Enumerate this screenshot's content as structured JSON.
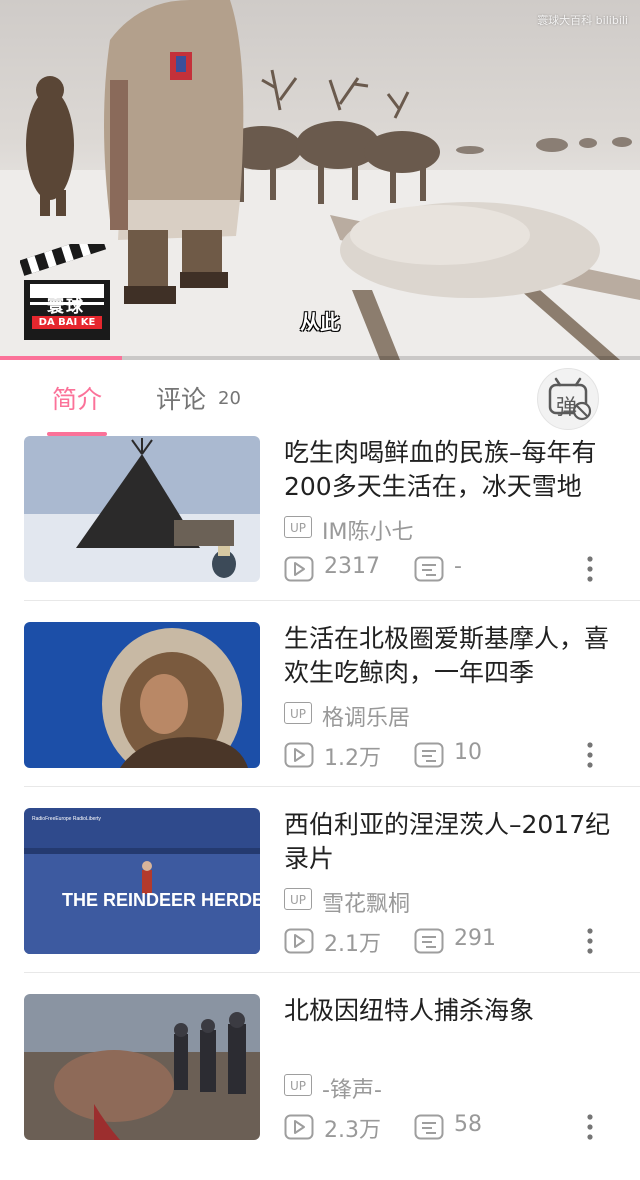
{
  "player": {
    "watermark": "寰球大百科 bilibili",
    "subtitle": "从此",
    "logo_title": "寰球",
    "logo_subtitle": "DA BAI KE",
    "progress_fraction": 0.19
  },
  "tabs": {
    "intro_label": "简介",
    "comments_label": "评论",
    "comments_count": "20",
    "danmaku_char": "弹"
  },
  "videos": [
    {
      "title": "吃生肉喝鲜血的民族–每年有200多天生活在，冰天雪地",
      "up_label": "UP",
      "uploader": "IM陈小七",
      "plays": "2317",
      "danmaku": "-"
    },
    {
      "title": "生活在北极圈爱斯基摩人，喜欢生吃鲸肉，一年四季",
      "up_label": "UP",
      "uploader": "格调乐居",
      "plays": "1.2万",
      "danmaku": "10"
    },
    {
      "title": "西伯利亚的涅涅茨人–2017纪录片",
      "up_label": "UP",
      "uploader": "雪花飘桐",
      "plays": "2.1万",
      "danmaku": "291",
      "thumb_text": "THE REINDEER HERDERS",
      "thumb_corner": "RadioFreeEurope RadioLiberty"
    },
    {
      "title": "北极因纽特人捕杀海象",
      "up_label": "UP",
      "uploader": "-锋声-",
      "plays": "2.3万",
      "danmaku": "58"
    }
  ],
  "colors": {
    "accent": "#fb7299",
    "secondary_text": "#999999"
  }
}
